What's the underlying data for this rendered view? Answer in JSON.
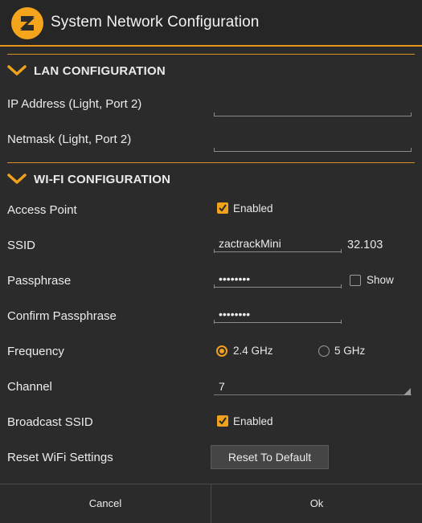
{
  "window": {
    "title": "System Network Configuration",
    "logo_icon": "zactrack-logo"
  },
  "colors": {
    "accent": "#F0A21D",
    "background": "#2B2B2B",
    "text": "#ECECEC"
  },
  "lan": {
    "header": "LAN CONFIGURATION",
    "ip_label": "IP Address (Light, Port 2)",
    "ip_value": "",
    "netmask_label": "Netmask (Light, Port 2)",
    "netmask_value": ""
  },
  "wifi": {
    "header": "WI-FI CONFIGURATION",
    "access_point": {
      "label": "Access Point",
      "checkbox_label": "Enabled",
      "checked": true
    },
    "ssid": {
      "label": "SSID",
      "value": "zactrackMini",
      "suffix": "32.103"
    },
    "passphrase": {
      "label": "Passphrase",
      "value": "••••••••",
      "show_label": "Show",
      "show_checked": false
    },
    "confirm": {
      "label": "Confirm Passphrase",
      "value": "••••••••"
    },
    "frequency": {
      "label": "Frequency",
      "options": [
        "2.4 GHz",
        "5 GHz"
      ],
      "selected": "2.4 GHz"
    },
    "channel": {
      "label": "Channel",
      "value": "7"
    },
    "broadcast": {
      "label": "Broadcast SSID",
      "checkbox_label": "Enabled",
      "checked": true
    },
    "reset": {
      "label": "Reset WiFi Settings",
      "button_label": "Reset To Default"
    }
  },
  "footer": {
    "cancel_label": "Cancel",
    "ok_label": "Ok"
  }
}
